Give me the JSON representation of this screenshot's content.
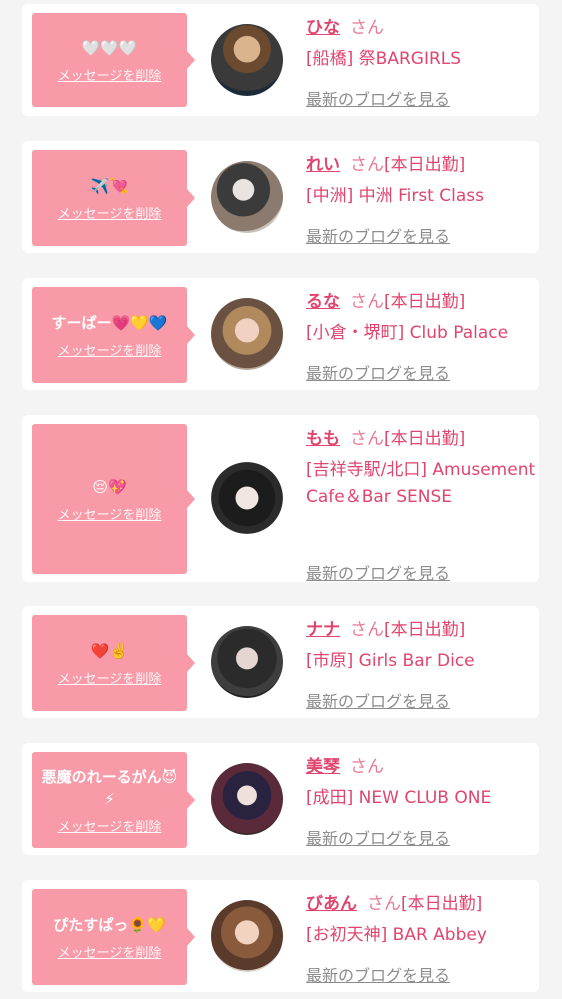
{
  "delete_label": "メッセージを削除",
  "blog_label": "最新のブログを見る",
  "honorific": "さん",
  "entries": [
    {
      "message": "🤍🤍🤍",
      "name": "ひな",
      "status": "",
      "shop": "[船橋] 祭BARGIRLS"
    },
    {
      "message": "✈️💘",
      "name": "れい",
      "status": "[本日出勤]",
      "shop": "[中洲] 中洲 First Class"
    },
    {
      "message": "すーぱー💗💛💙",
      "name": "るな",
      "status": "[本日出勤]",
      "shop": "[小倉・堺町] Club Palace"
    },
    {
      "message": "😔💖",
      "name": "もも",
      "status": "[本日出勤]",
      "shop": "[吉祥寺駅/北口] Amusement Cafe＆Bar SENSE"
    },
    {
      "message": "❤️✌️",
      "name": "ナナ",
      "status": "[本日出勤]",
      "shop": "[市原] Girls Bar Dice"
    },
    {
      "message": "悪魔のれーるがん😈⚡",
      "name": "美琴",
      "status": "",
      "shop": "[成田] NEW CLUB ONE"
    },
    {
      "message": "ぴたすぱっ🌻💛",
      "name": "びあん",
      "status": "[本日出勤]",
      "shop": "[お初天神] BAR Abbey"
    }
  ],
  "colors": {
    "page_bg": "#f4f4f4",
    "bubble": "#f89aa8",
    "accent": "#e0456e",
    "muted": "#8c8c8c"
  }
}
